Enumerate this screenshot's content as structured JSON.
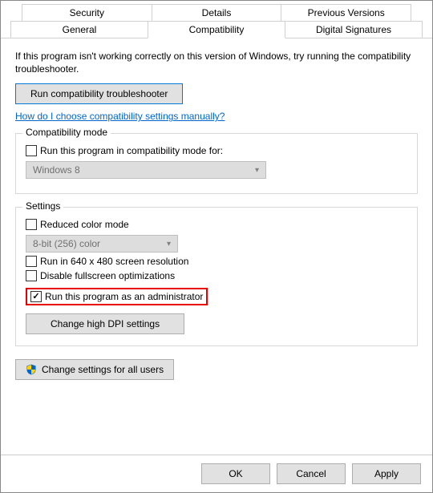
{
  "tabs": {
    "row1": [
      "Security",
      "Details",
      "Previous Versions"
    ],
    "row2": [
      "General",
      "Compatibility",
      "Digital Signatures"
    ],
    "active": "Compatibility"
  },
  "intro": "If this program isn't working correctly on this version of Windows, try running the compatibility troubleshooter.",
  "troubleshoot_btn": "Run compatibility troubleshooter",
  "help_link": "How do I choose compatibility settings manually?",
  "compat_mode": {
    "title": "Compatibility mode",
    "checkbox_label": "Run this program in compatibility mode for:",
    "checked": false,
    "select_value": "Windows 8"
  },
  "settings": {
    "title": "Settings",
    "reduced_color": {
      "label": "Reduced color mode",
      "checked": false
    },
    "color_select": "8-bit (256) color",
    "run_640": {
      "label": "Run in 640 x 480 screen resolution",
      "checked": false
    },
    "disable_fullscreen": {
      "label": "Disable fullscreen optimizations",
      "checked": false
    },
    "run_admin": {
      "label": "Run this program as an administrator",
      "checked": true
    },
    "change_dpi_btn": "Change high DPI settings"
  },
  "change_all_users_btn": "Change settings for all users",
  "footer": {
    "ok": "OK",
    "cancel": "Cancel",
    "apply": "Apply"
  }
}
